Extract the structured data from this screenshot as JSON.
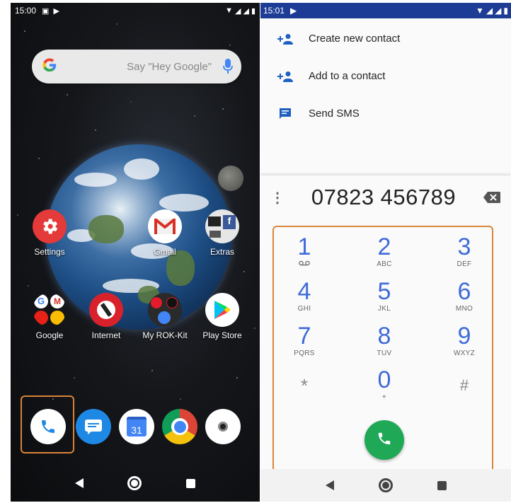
{
  "left_screen": {
    "statusbar": {
      "time": "15:00"
    },
    "search": {
      "placeholder": "Say \"Hey Google\""
    },
    "apps": [
      {
        "label": "Settings"
      },
      {
        "label": "Gmail"
      },
      {
        "label": "Extras"
      },
      {
        "label": "Google"
      },
      {
        "label": "Internet"
      },
      {
        "label": "My ROK-Kit"
      },
      {
        "label": "Play Store"
      }
    ],
    "dock": {
      "calendar_day": "31"
    }
  },
  "right_screen": {
    "statusbar": {
      "time": "15:01"
    },
    "actions": [
      {
        "label": "Create new contact",
        "icon": "add-person-icon"
      },
      {
        "label": "Add to a contact",
        "icon": "add-person-icon"
      },
      {
        "label": "Send SMS",
        "icon": "sms-icon"
      }
    ],
    "dialed_number": "07823 456789",
    "keys": [
      {
        "num": "1",
        "sub": "voicemail"
      },
      {
        "num": "2",
        "sub": "ABC"
      },
      {
        "num": "3",
        "sub": "DEF"
      },
      {
        "num": "4",
        "sub": "GHI"
      },
      {
        "num": "5",
        "sub": "JKL"
      },
      {
        "num": "6",
        "sub": "MNO"
      },
      {
        "num": "7",
        "sub": "PQRS"
      },
      {
        "num": "8",
        "sub": "TUV"
      },
      {
        "num": "9",
        "sub": "WXYZ"
      },
      {
        "num": "*",
        "sub": ""
      },
      {
        "num": "0",
        "sub": "+"
      },
      {
        "num": "#",
        "sub": ""
      }
    ]
  },
  "colors": {
    "accent": "#3f6bd8",
    "call_green": "#1fa855",
    "highlight": "#d9843a",
    "statusbar_blue": "#1c3c96"
  }
}
